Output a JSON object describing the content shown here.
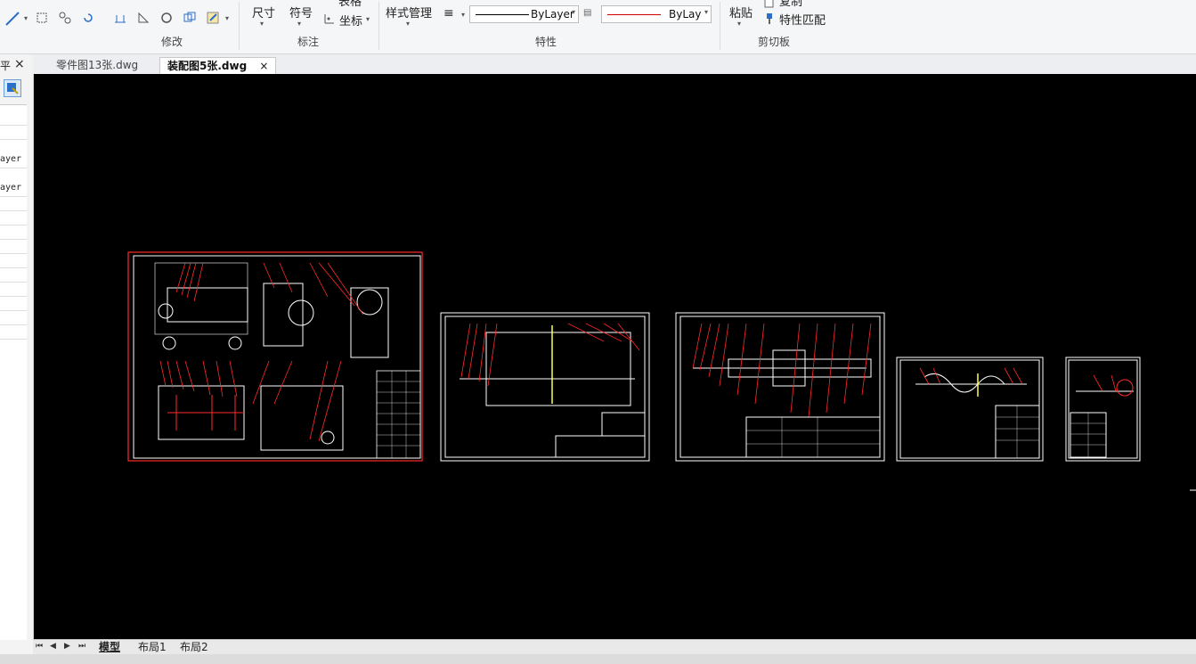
{
  "ribbon": {
    "modify_group": "修改",
    "annotate_group": "标注",
    "properties_group": "特性",
    "clipboard_group": "剪切板",
    "dimension_label": "尺寸",
    "symbol_label": "符号",
    "table_label": "表格",
    "coord_label": "坐标",
    "style_manager_label": "样式管理",
    "linetype_value": "ByLayer",
    "lineweight_value": "ByLay",
    "paste_label": "粘贴",
    "copy_label": "复制",
    "match_prop_label": "特性匹配"
  },
  "left_panel": {
    "close_glyph": "×",
    "pin_glyph": "平",
    "items": [
      "ayer",
      "ayer"
    ]
  },
  "doc_tabs": [
    {
      "label": "零件图13张.dwg",
      "active": false
    },
    {
      "label": "装配图5张.dwg",
      "active": true
    }
  ],
  "doc_tab_close": "×",
  "layout_tabs": [
    "模型",
    "布局1",
    "布局2"
  ],
  "colors": {
    "canvas": "#000000",
    "leader": "#ff0000",
    "frame": "#ffffff"
  }
}
